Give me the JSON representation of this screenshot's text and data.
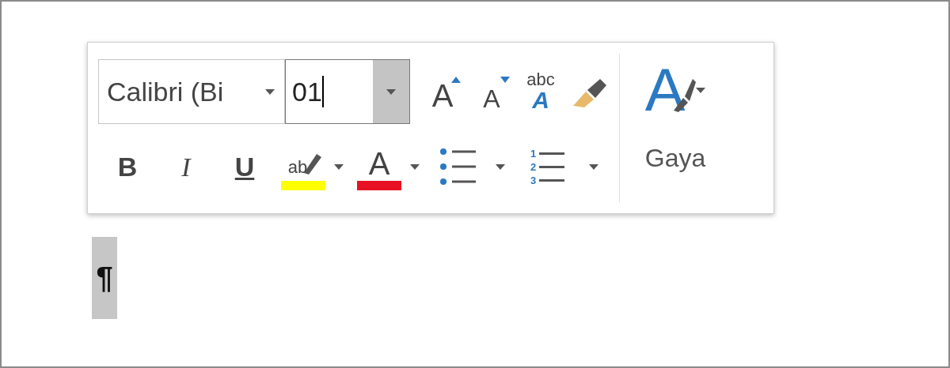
{
  "font_box": {
    "value": "Calibri (Bi"
  },
  "size_box": {
    "value": "01",
    "focused": true
  },
  "row1_buttons": [
    {
      "kind": "grow",
      "glyph": "A"
    },
    {
      "kind": "shrink",
      "glyph": "A"
    },
    {
      "kind": "styles-text",
      "glyph": "abc",
      "glyph2": "A"
    },
    {
      "kind": "painter"
    }
  ],
  "row2_buttons": [
    {
      "kind": "bold",
      "glyph": "B"
    },
    {
      "kind": "italic",
      "glyph": "I"
    },
    {
      "kind": "underline",
      "glyph": "U"
    },
    {
      "kind": "highlight",
      "glyph": "ab",
      "color": "#ffff00"
    },
    {
      "kind": "font-color",
      "glyph": "A",
      "color": "#e81123"
    },
    {
      "kind": "bullets"
    },
    {
      "kind": "numbering",
      "glyphs": [
        "1",
        "2",
        "3"
      ]
    }
  ],
  "styles": {
    "glyph": "A",
    "label": "Gaya"
  },
  "paragraph_mark": {
    "glyph": "¶",
    "selected": true
  }
}
